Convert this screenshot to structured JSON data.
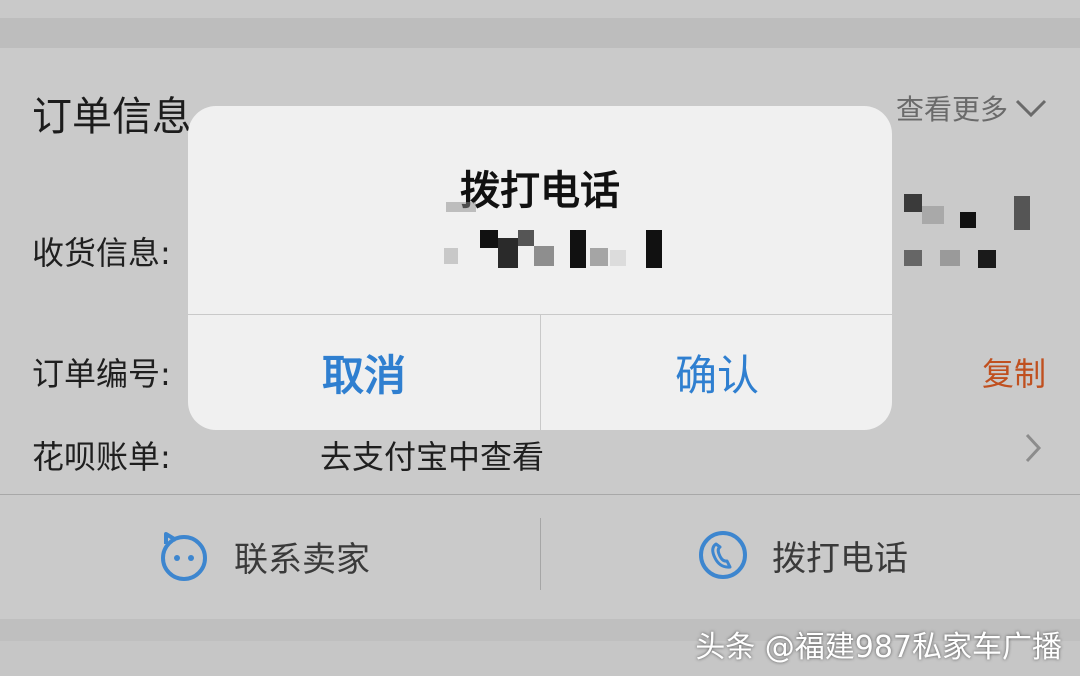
{
  "order_info": {
    "title": "订单信息",
    "more_label": "查看更多"
  },
  "rows": [
    {
      "label": "收货信息:"
    },
    {
      "label": "订单编号:",
      "action": "复制"
    },
    {
      "label": "花呗账单:",
      "value": "去支付宝中查看"
    }
  ],
  "bottom_actions": {
    "contact_seller": "联系卖家",
    "call": "拨打电话"
  },
  "dialog": {
    "title": "拨打电话",
    "cancel": "取消",
    "confirm": "确认"
  },
  "watermark": "头条 @福建987私家车广播",
  "icons": {
    "chevron_down": "chevron-down-icon",
    "chevron_right": "chevron-right-icon",
    "chat": "chat-face-icon",
    "phone": "phone-icon"
  },
  "colors": {
    "accent_blue": "#2f7fd0",
    "copy_orange": "#c0501f",
    "icon_blue": "#3d86cf"
  }
}
